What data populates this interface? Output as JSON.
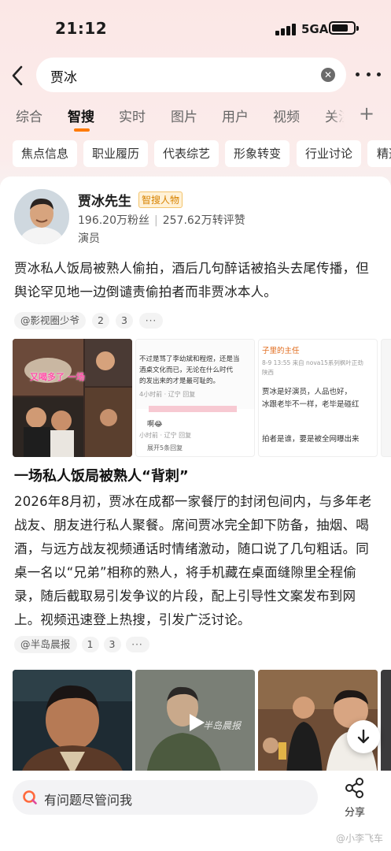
{
  "status_bar": {
    "time": "21:12",
    "network": "5GA"
  },
  "search": {
    "query": "贾冰"
  },
  "tabs": [
    {
      "label": "综合"
    },
    {
      "label": "智搜"
    },
    {
      "label": "实时"
    },
    {
      "label": "图片"
    },
    {
      "label": "用户"
    },
    {
      "label": "视频"
    },
    {
      "label": "关注"
    }
  ],
  "active_tab": "智搜",
  "chips": [
    {
      "label": "焦点信息"
    },
    {
      "label": "职业履历"
    },
    {
      "label": "代表综艺"
    },
    {
      "label": "形象转变"
    },
    {
      "label": "行业讨论"
    },
    {
      "label": "精选"
    }
  ],
  "profile": {
    "name": "贾冰先生",
    "badge": "智搜人物",
    "followers": "196.20万粉丝",
    "interactions": "257.62万转评赞",
    "role": "演员"
  },
  "summary": {
    "text": "贾冰私人饭局被熟人偷拍，酒后几句醉话被掐头去尾传播，但舆论罕见地一边倒谴责偷拍者而非贾冰本人。",
    "source": "@影视圈少爷",
    "refs": [
      "2",
      "3"
    ],
    "more": "···"
  },
  "images1": {
    "caption_overlay": "又喝多了 一场",
    "comment_card_1": {
      "line1": "不过是骂了李幼斌和程煜，还是当",
      "line2": "酒桌文化而已，无论在什么时代",
      "line3": "的发出来的才是最可耻的。",
      "meta": "4小时前 · 辽宁  回复",
      "reply": "啊😂",
      "reply_meta": "小时前 · 辽宁  回复",
      "expand": "展开5条回复"
    },
    "comment_card_2": {
      "user": "子里的主任",
      "meta": "8-9 13:55  来自 nova15系列枫叶正劲",
      "loc": "陕西",
      "line1": "贾冰是好演员，人品也好，",
      "line2": "冰跟老毕不一样，老毕是碰红",
      "line3": "拍者是谁，要是被全网曝出来"
    }
  },
  "section": {
    "title": "一场私人饭局被熟人“背刺”",
    "text": "2026年8月初，贾冰在成都一家餐厅的封闭包间内，与多年老战友、朋友进行私人聚餐。席间贾冰完全卸下防备，抽烟、喝酒，与远方战友视频通话时情绪激动，随口说了几句粗话。同桌一名以“兄弟”相称的熟人，将手机藏在桌面缝隙里全程偷录，随后截取易引发争议的片段，配上引导性文案发布到网上。视频迅速登上热搜，引发广泛讨论。",
    "source": "@半岛晨报",
    "refs": [
      "1",
      "3"
    ],
    "more": "···"
  },
  "images2": {
    "video_watermark": "半岛晨报"
  },
  "bottom": {
    "ask_placeholder": "有问题尽管问我",
    "share_label": "分享"
  },
  "watermark": "@小李飞车",
  "colors": {
    "accent": "#ff7a00",
    "badge": "#d78200",
    "header_bg": "#fbe7e6"
  }
}
